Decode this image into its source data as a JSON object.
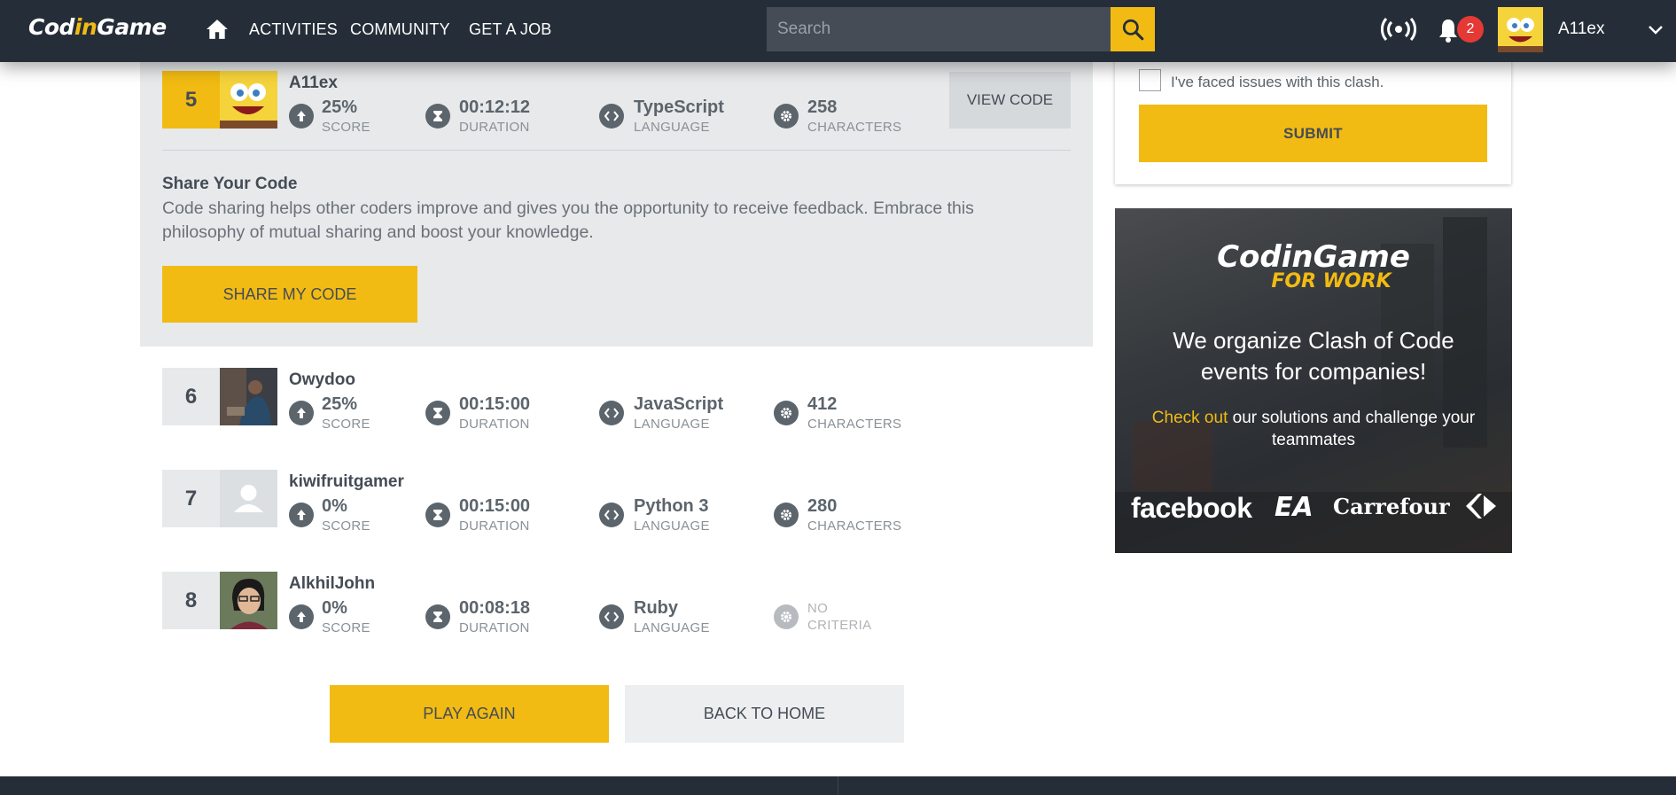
{
  "nav": {
    "logo_part1": "Cod",
    "logo_part2": "in",
    "logo_part3": "Game",
    "links": [
      "ACTIVITIES",
      "COMMUNITY",
      "GET A JOB"
    ],
    "search_placeholder": "Search",
    "notification_count": "2",
    "username": "A11ex",
    "accent_color": "#f2bb13",
    "bg_color": "#252e38"
  },
  "players": [
    {
      "rank": "5",
      "name": "A11ex",
      "score": "25%",
      "duration": "00:12:12",
      "language": "TypeScript",
      "characters": "258"
    },
    {
      "rank": "6",
      "name": "Owydoo",
      "score": "25%",
      "duration": "00:15:00",
      "language": "JavaScript",
      "characters": "412"
    },
    {
      "rank": "7",
      "name": "kiwifruitgamer",
      "score": "0%",
      "duration": "00:15:00",
      "language": "Python 3",
      "characters": "280"
    },
    {
      "rank": "8",
      "name": "AlkhilJohn",
      "score": "0%",
      "duration": "00:08:18",
      "language": "Ruby",
      "no_criteria_1": "NO",
      "no_criteria_2": "CRITERIA"
    }
  ],
  "labels": {
    "score": "SCORE",
    "duration": "DURATION",
    "language": "LANGUAGE",
    "characters": "CHARACTERS"
  },
  "view_code": "VIEW CODE",
  "share": {
    "title": "Share Your Code",
    "text": "Code sharing helps other coders improve and gives you the opportunity to receive feedback. Embrace this philosophy of mutual sharing and boost your knowledge.",
    "button": "SHARE MY CODE"
  },
  "actions": {
    "play_again": "PLAY AGAIN",
    "back_home": "BACK TO HOME"
  },
  "feedback": {
    "checkbox_label": "I've faced issues with this clash.",
    "submit": "SUBMIT"
  },
  "ad": {
    "logo_part1": "Cod",
    "logo_part2": "in",
    "logo_part3": "Game",
    "for_work": "FOR WORK",
    "headline": "We organize Clash of Code events for companies!",
    "sub_highlight": "Check out",
    "sub_rest": " our solutions and challenge your teammates",
    "brands": [
      "facebook",
      "EA",
      "Carrefour"
    ]
  }
}
